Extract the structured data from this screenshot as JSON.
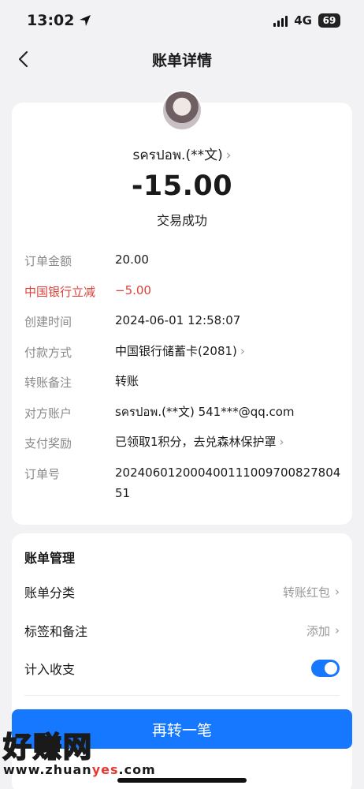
{
  "status_bar": {
    "time": "13:02",
    "network": "4G",
    "battery": "69"
  },
  "nav": {
    "title": "账单详情"
  },
  "bill": {
    "payee": "ꜱครปอพ.(**文)",
    "amount": "-15.00",
    "status": "交易成功",
    "details": [
      {
        "label": "订单金额",
        "value": "20.00"
      },
      {
        "label": "中国银行立减",
        "value": "−5.00"
      },
      {
        "label": "创建时间",
        "value": "2024-06-01 12:58:07"
      },
      {
        "label": "付款方式",
        "value": "中国银行储蓄卡(2081)"
      },
      {
        "label": "转账备注",
        "value": "转账"
      },
      {
        "label": "对方账户",
        "value": "ꜱครปอพ.(**文) 541***@qq.com"
      },
      {
        "label": "支付奖励",
        "value": "已领取1积分，去兑森林保护罩"
      },
      {
        "label": "订单号",
        "value": "20240601200040011100970082780451"
      }
    ]
  },
  "manage": {
    "title": "账单管理",
    "category_label": "账单分类",
    "category_value": "转账红包",
    "tags_label": "标签和备注",
    "tags_value": "添加",
    "include_label": "计入收支",
    "include_on": true
  },
  "action": {
    "again_label": "再转一笔"
  },
  "watermark": {
    "big": "好赚网",
    "small_prefix": "www.zhuan",
    "small_highlight": "yes",
    "small_suffix": ".com"
  },
  "colors": {
    "accent": "#1677ff",
    "discount_red": "#e0403a"
  }
}
